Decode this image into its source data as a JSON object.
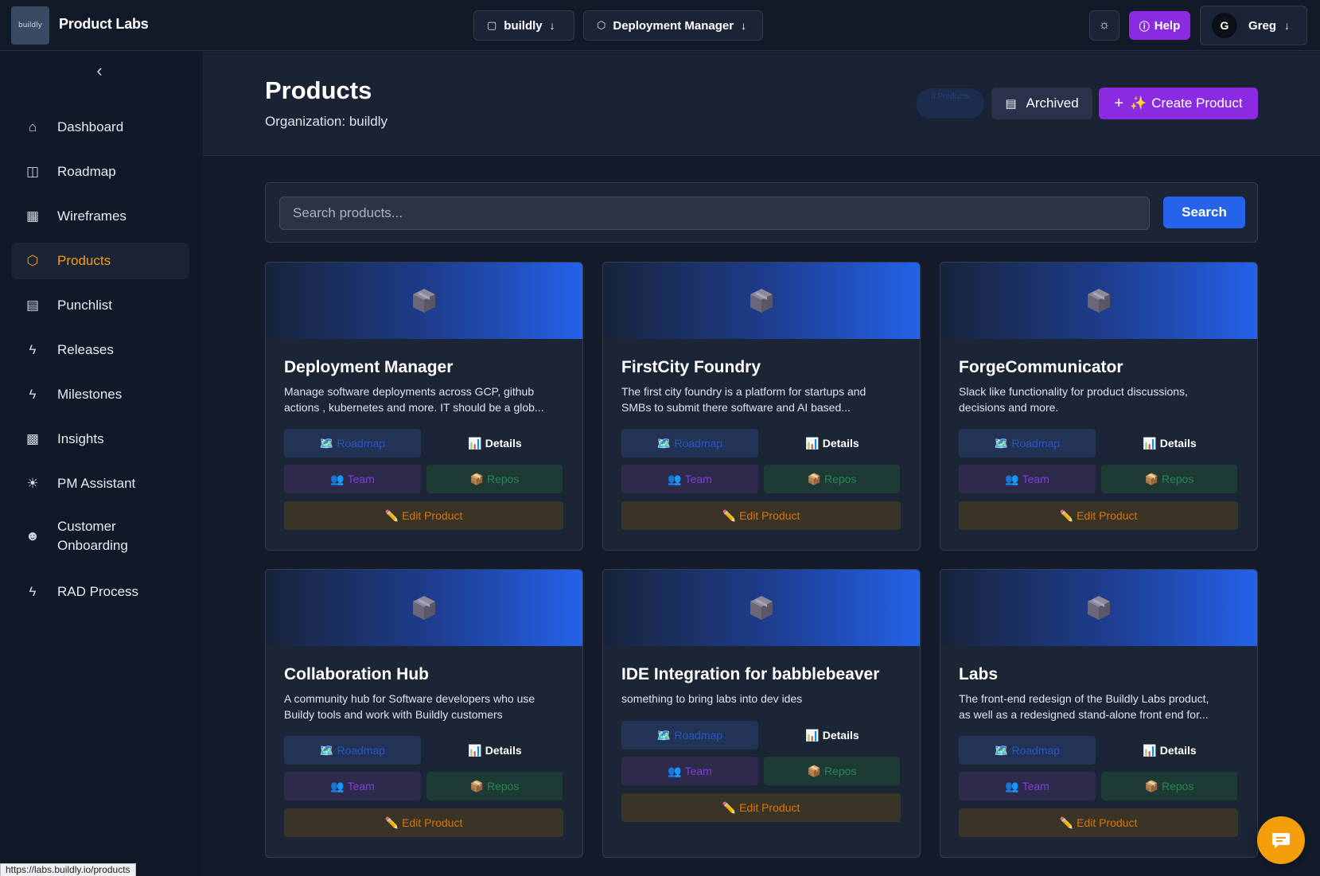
{
  "app": {
    "title": "Product Labs",
    "logo_text": "buildly"
  },
  "topbar": {
    "org_dropdown": "buildly",
    "product_dropdown": "Deployment Manager",
    "help_label": "Help",
    "user": {
      "initial": "G",
      "name": "Greg"
    }
  },
  "sidebar": {
    "items": [
      {
        "label": "Dashboard",
        "icon": "home-icon"
      },
      {
        "label": "Roadmap",
        "icon": "columns-icon"
      },
      {
        "label": "Wireframes",
        "icon": "grid-icon"
      },
      {
        "label": "Products",
        "icon": "package-icon",
        "active": true
      },
      {
        "label": "Punchlist",
        "icon": "clipboard-icon"
      },
      {
        "label": "Releases",
        "icon": "zap-icon"
      },
      {
        "label": "Milestones",
        "icon": "zap-icon"
      },
      {
        "label": "Insights",
        "icon": "bar-chart-icon"
      },
      {
        "label": "PM Assistant",
        "icon": "lightbulb-icon"
      },
      {
        "label": "Customer Onboarding",
        "icon": "user-plus-icon"
      },
      {
        "label": "RAD Process",
        "icon": "zap-icon"
      }
    ]
  },
  "header": {
    "title": "Products",
    "organization": "Organization: buildly",
    "count_pill": "6 Products",
    "archived_label": "Archived",
    "create_label": "Create Product",
    "create_sparkle": "✨"
  },
  "search": {
    "placeholder": "Search products...",
    "button_label": "Search"
  },
  "card_buttons": {
    "roadmap": "Roadmap",
    "details": "Details",
    "team": "Team",
    "repos": "Repos",
    "edit": "Edit Product",
    "roadmap_emoji": "🗺️",
    "details_emoji": "📊",
    "team_emoji": "👥",
    "repos_emoji": "📦",
    "edit_emoji": "✏️"
  },
  "products": [
    {
      "name": "Deployment Manager",
      "description_line1": "Manage software deployments across GCP, github",
      "description_line2": "actions , kubernetes and more. IT should be a glob..."
    },
    {
      "name": "FirstCity Foundry",
      "description_line1": "The first city foundry is a platform for startups and",
      "description_line2": "SMBs to submit there software and AI based..."
    },
    {
      "name": "ForgeCommunicator",
      "description_line1": "Slack like functionality for product discussions,",
      "description_line2": "decisions and more."
    },
    {
      "name": "Collaboration Hub",
      "description_line1": "A community hub for Software developers who use",
      "description_line2": "Buildy tools and work with Buildly customers"
    },
    {
      "name": "IDE Integration for babblebeaver",
      "description_line1": "something to bring labs into dev ides",
      "description_line2": ""
    },
    {
      "name": "Labs",
      "description_line1": "The front-end redesign of the Buildly Labs product,",
      "description_line2": "as well as a redesigned stand-alone front end for..."
    }
  ],
  "status_bar": {
    "url": "https://labs.buildly.io/products"
  },
  "colors": {
    "accent": "#8a2be2",
    "primary": "#2563eb",
    "active_nav": "#f59e0b",
    "background": "#141c2c"
  }
}
